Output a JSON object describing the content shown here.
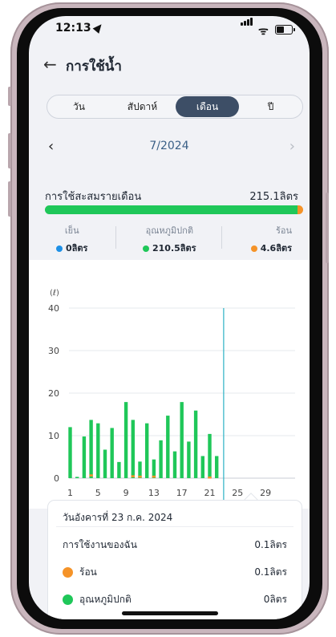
{
  "status_bar": {
    "time": "12:13",
    "wifi": "ᯤ"
  },
  "header": {
    "back_icon": "arrow-left-icon",
    "back_glyph": "←",
    "title": "การใช้น้ำ"
  },
  "segments": [
    {
      "label": "วัน",
      "active": false
    },
    {
      "label": "สัปดาห์",
      "active": false
    },
    {
      "label": "เดือน",
      "active": true
    },
    {
      "label": "ปี",
      "active": false
    }
  ],
  "period": {
    "label": "7/2024",
    "prev": "‹",
    "next": "›"
  },
  "summary": {
    "label": "การใช้สะสมรายเดือน",
    "total": "215.1ลิตร",
    "green_fraction": 0.978,
    "orange_fraction": 0.022
  },
  "legend": [
    {
      "title": "เย็น",
      "value": "0ลิตร",
      "color": "#1e90e6"
    },
    {
      "title": "อุณหภูมิปกติ",
      "value": "210.5ลิตร",
      "color": "#1fc759"
    },
    {
      "title": "ร้อน",
      "value": "4.6ลิตร",
      "color": "#f59328"
    }
  ],
  "chart_data": {
    "type": "bar",
    "ylabel": "(ℓ)",
    "ylim": [
      0,
      40
    ],
    "yticks": [
      "0",
      "10",
      "20",
      "30",
      "40"
    ],
    "xticks": [
      "1",
      "5",
      "9",
      "13",
      "17",
      "21",
      "25",
      "29"
    ],
    "days": [
      1,
      2,
      3,
      4,
      5,
      6,
      7,
      8,
      9,
      10,
      11,
      12,
      13,
      14,
      15,
      16,
      17,
      18,
      19,
      20,
      21,
      22,
      23
    ],
    "series": [
      {
        "name": "อุณหภูมิปกติ",
        "color": "#1fc759",
        "values": [
          12,
          0.3,
          9.8,
          13.7,
          12.9,
          6.7,
          11.8,
          3.8,
          17.9,
          13.7,
          3.9,
          12.9,
          4.4,
          8.9,
          14.7,
          6.3,
          17.9,
          8.6,
          15.9,
          5.2,
          10.4,
          5.2,
          0
        ]
      },
      {
        "name": "ร้อน",
        "color": "#f59328",
        "values": [
          0,
          0,
          0,
          0.6,
          0,
          0,
          0,
          0,
          0,
          0.4,
          0.3,
          0,
          0.3,
          0,
          0,
          0,
          0,
          0,
          0,
          0,
          0.1,
          0,
          0
        ]
      }
    ],
    "selected_day": 23,
    "selected_value": 40
  },
  "detail": {
    "date": "วันอังคารที่ 23 ก.ค. 2024",
    "my_usage_label": "การใช้งานของฉัน",
    "my_usage_value": "0.1ลิตร",
    "hot_label": "ร้อน",
    "hot_value": "0.1ลิตร",
    "hot_color": "#f59328",
    "normal_label": "อุณหภูมิปกติ",
    "normal_value": "0ลิตร",
    "normal_color": "#1fc759"
  }
}
